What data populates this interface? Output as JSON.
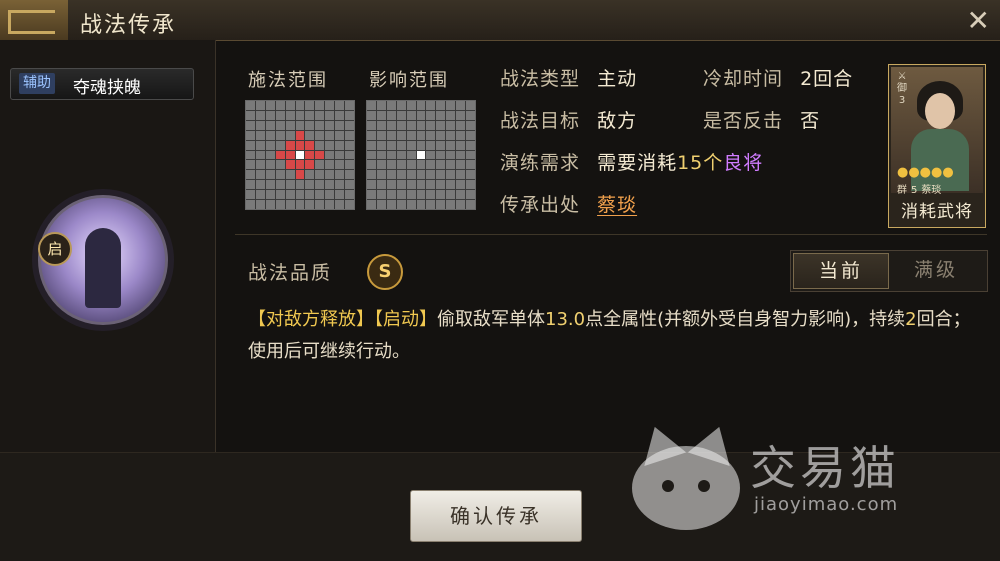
{
  "window": {
    "title": "战法传承",
    "close_icon": "close-icon"
  },
  "skill": {
    "tag": "辅助",
    "name": "夺魂挟魄",
    "icon_badge": "启"
  },
  "range": {
    "cast_label": "施法范围",
    "effect_label": "影响范围"
  },
  "info": {
    "type_label": "战法类型",
    "type_value": "主动",
    "cooldown_label": "冷却时间",
    "cooldown_value": "2回合",
    "target_label": "战法目标",
    "target_value": "敌方",
    "counter_label": "是否反击",
    "counter_value": "否",
    "req_label": "演练需求",
    "req_prefix": "需要消耗",
    "req_num": "15个",
    "req_item": "良将",
    "source_label": "传承出处",
    "source_value": "蔡琰"
  },
  "hero_card": {
    "type_text": "御",
    "level": "3",
    "stars": "●●●●●",
    "faction": "群",
    "cost": "5",
    "name": "蔡琰",
    "consume_label": "消耗武将"
  },
  "quality": {
    "label": "战法品质",
    "grade": "S"
  },
  "toggle": {
    "current": "当前",
    "max": "满级"
  },
  "description": {
    "part1": "【对敌方释放】【启动】",
    "part2": "偷取敌军单体",
    "num1": "13.0",
    "part3": "点全属性(并额外受自身智力影响)，持续",
    "num2": "2",
    "part4": "回合；使用后可继续行动。"
  },
  "confirm_button": "确认传承",
  "watermark": {
    "text": "交易猫",
    "url": "jiaoyimao.com"
  }
}
